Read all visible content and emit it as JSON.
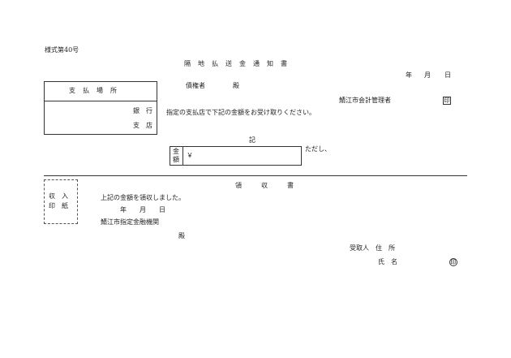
{
  "form_number": "様式第40号",
  "title": "隔　地　払　送　金　通　知　書",
  "date": {
    "year": "年",
    "month": "月",
    "day": "日"
  },
  "payment_place": {
    "header": "支　払　場　所",
    "bank": "銀　行",
    "branch": "支　店"
  },
  "creditor": {
    "label": "債権者",
    "honorific": "殿"
  },
  "issuer": "鯖江市会計管理者",
  "seal_char": "印",
  "instruction": "指定の支払店で下記の金額をお受け取りください。",
  "ki": "記",
  "amount": {
    "label_top": "金",
    "label_bottom": "額",
    "currency": "￥"
  },
  "proviso": "ただし、",
  "receipt": {
    "title": "領　　　収　　　書",
    "statement": "上記の金額を領収しました。",
    "date": {
      "year": "年",
      "month": "月",
      "day": "日"
    },
    "institution": "鯖江市指定金融機関",
    "honorific": "殿",
    "recipient_address_label": "受取人　住　所",
    "recipient_name_label": "氏　名"
  },
  "stamp": {
    "line1": "収　入",
    "line2": "印　紙"
  }
}
